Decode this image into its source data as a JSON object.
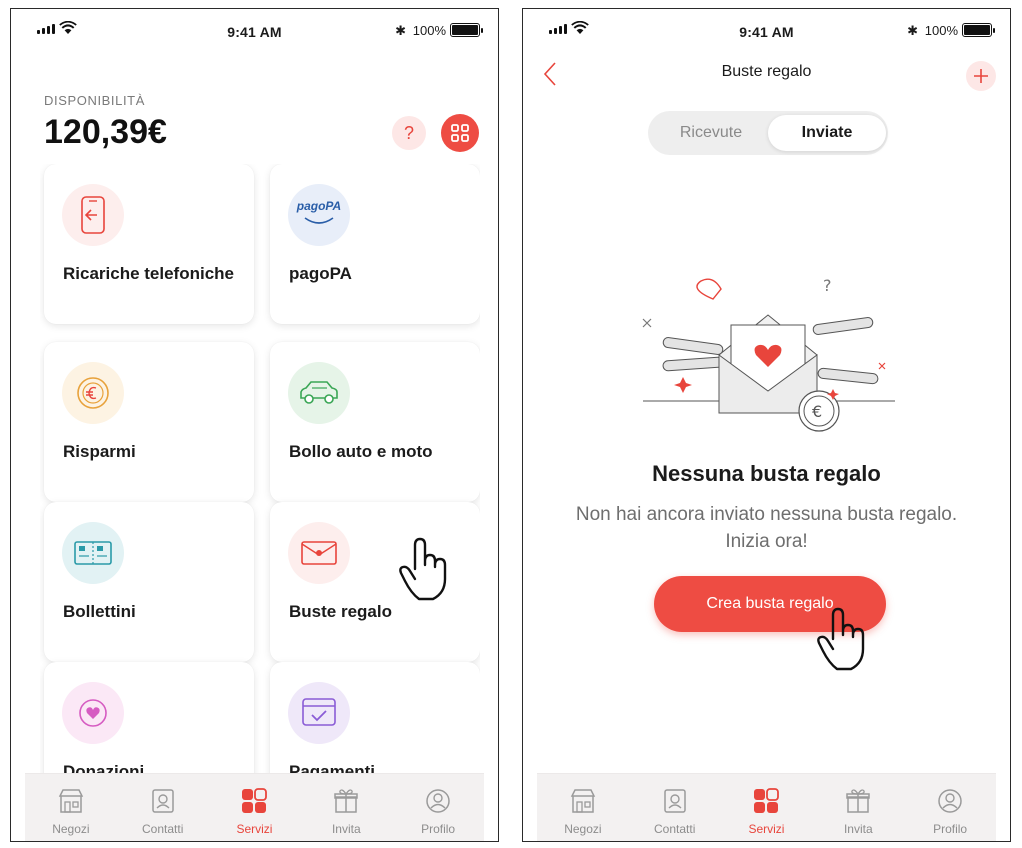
{
  "status_bar": {
    "time": "9:41 AM",
    "battery": "100%",
    "battery_level": 1.0
  },
  "left_screen": {
    "balance_label": "DISPONIBILITÀ",
    "balance_value": "120,39€",
    "help_symbol": "?",
    "services": [
      {
        "label": "Ricariche telefoniche",
        "icon": "phone-topup-icon"
      },
      {
        "label": "pagoPA",
        "icon": "pagopa-logo-icon",
        "logo_text": "pagoPA"
      },
      {
        "label": "Risparmi",
        "icon": "euro-coin-icon"
      },
      {
        "label": "Bollo auto e moto",
        "icon": "car-icon"
      },
      {
        "label": "Bollettini",
        "icon": "payment-slip-icon"
      },
      {
        "label": "Buste regalo",
        "icon": "gift-envelope-icon"
      },
      {
        "label": "Donazioni",
        "icon": "heart-donation-icon"
      },
      {
        "label": "Pagamenti",
        "icon": "online-payment-icon"
      }
    ]
  },
  "right_screen": {
    "title": "Buste regalo",
    "segments": [
      "Ricevute",
      "Inviate"
    ],
    "selected_segment": "Inviate",
    "empty_title": "Nessuna busta regalo",
    "empty_description": "Non hai ancora inviato nessuna busta regalo. Inizia ora!",
    "cta_label": "Crea busta regalo"
  },
  "tab_bar": {
    "items": [
      {
        "label": "Negozi",
        "icon": "store-icon"
      },
      {
        "label": "Contatti",
        "icon": "contacts-icon"
      },
      {
        "label": "Servizi",
        "icon": "services-grid-icon"
      },
      {
        "label": "Invita",
        "icon": "gift-icon"
      },
      {
        "label": "Profilo",
        "icon": "profile-icon"
      }
    ],
    "active": "Servizi"
  },
  "colors": {
    "accent": "#ee4c43",
    "accent_light": "#fde7e6",
    "text": "#1b1b1b",
    "muted": "#8d8d8d"
  }
}
